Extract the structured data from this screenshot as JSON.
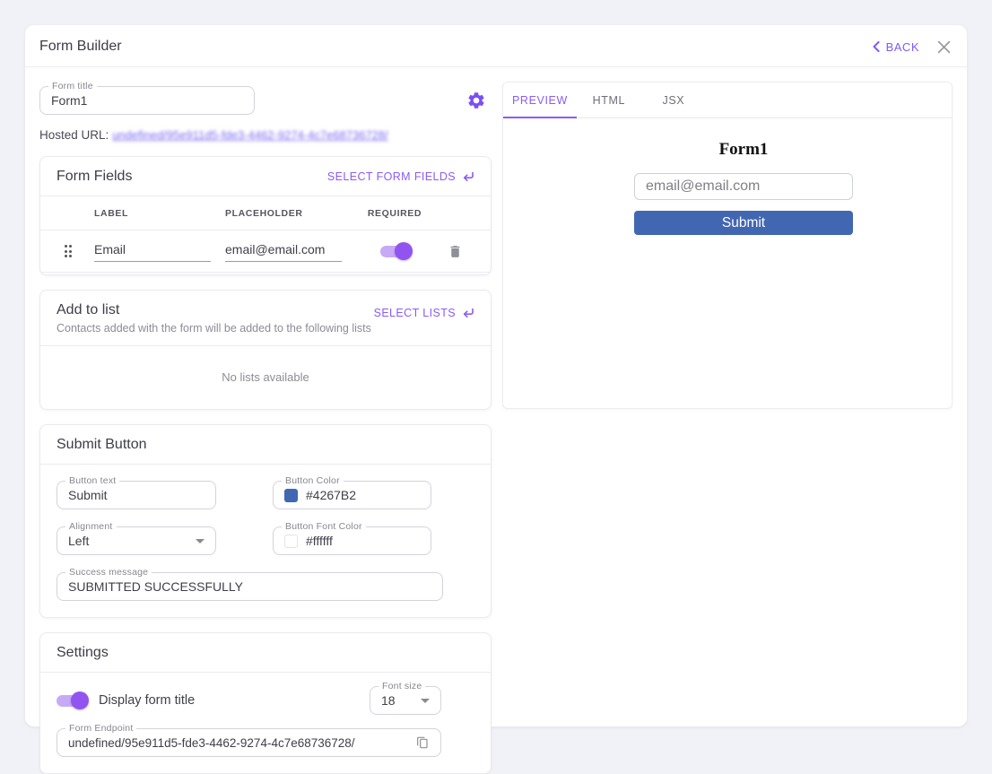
{
  "header": {
    "title": "Form Builder",
    "back_label": "BACK"
  },
  "form_title_field": {
    "label": "Form title",
    "value": "Form1"
  },
  "hosted_url": {
    "label": "Hosted URL:",
    "link": "undefined/95e911d5-fde3-4462-9274-4c7e68736728/"
  },
  "form_fields": {
    "title": "Form Fields",
    "action": "SELECT FORM FIELDS",
    "columns": [
      "LABEL",
      "PLACEHOLDER",
      "REQUIRED"
    ],
    "rows": [
      {
        "label": "Email",
        "placeholder": "email@email.com",
        "required": true
      }
    ]
  },
  "add_to_list": {
    "title": "Add to list",
    "subtitle": "Contacts added with the form will be added to the following lists",
    "action": "SELECT LISTS",
    "empty_message": "No lists available"
  },
  "submit_button": {
    "title": "Submit Button",
    "button_text": {
      "label": "Button text",
      "value": "Submit"
    },
    "button_color": {
      "label": "Button Color",
      "value": "#4267B2"
    },
    "alignment": {
      "label": "Alignment",
      "value": "Left"
    },
    "button_font_color": {
      "label": "Button Font Color",
      "value": "#ffffff"
    },
    "success_message": {
      "label": "Success message",
      "value": "SUBMITTED SUCCESSFULLY"
    }
  },
  "settings": {
    "title": "Settings",
    "display_form_title": {
      "label": "Display form title",
      "enabled": true
    },
    "font_size": {
      "label": "Font size",
      "value": "18"
    },
    "form_endpoint": {
      "label": "Form Endpoint",
      "value": "undefined/95e911d5-fde3-4462-9274-4c7e68736728/"
    }
  },
  "preview_panel": {
    "tabs": [
      {
        "label": "PREVIEW",
        "active": true
      },
      {
        "label": "HTML",
        "active": false
      },
      {
        "label": "JSX",
        "active": false
      }
    ],
    "form": {
      "title": "Form1",
      "email_placeholder": "email@email.com",
      "submit_label": "Submit",
      "submit_color": "#4267B2",
      "submit_font_color": "#ffffff"
    }
  },
  "colors": {
    "accent": "#8a5cf6",
    "button_blue": "#4267B2",
    "toggle_on": "#9254f0"
  },
  "icons": {
    "gear": "⚙",
    "close": "✕",
    "chevron_left": "‹",
    "return_arrow": "↵",
    "drag_handle": "⠿",
    "trash": "🗑",
    "caret_down": "▾",
    "copy": "⎘"
  }
}
